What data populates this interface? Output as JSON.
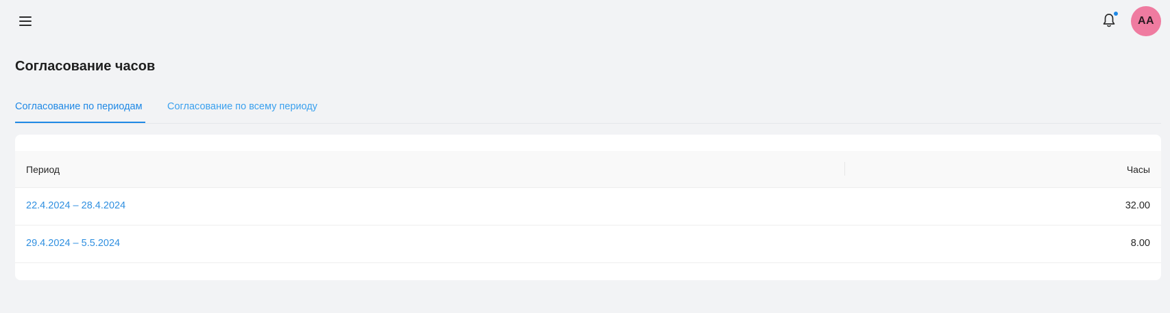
{
  "header": {
    "menu_icon": "hamburger-menu-icon",
    "notifications_icon": "bell-icon",
    "notification_dot_color": "#1e88e5",
    "avatar_initials": "AA",
    "avatar_color": "#ef7ba0"
  },
  "page": {
    "title": "Согласование часов"
  },
  "tabs": [
    {
      "label": "Согласование по периодам",
      "active": true
    },
    {
      "label": "Согласование по всему периоду",
      "active": false
    }
  ],
  "table": {
    "columns": {
      "period": "Период",
      "hours": "Часы"
    },
    "rows": [
      {
        "period": "22.4.2024 – 28.4.2024",
        "hours": "32.00"
      },
      {
        "period": "29.4.2024 – 5.5.2024",
        "hours": "8.00"
      }
    ]
  },
  "colors": {
    "accent": "#1e88e5",
    "link": "#2f8fe0",
    "background": "#f2f3f5"
  }
}
